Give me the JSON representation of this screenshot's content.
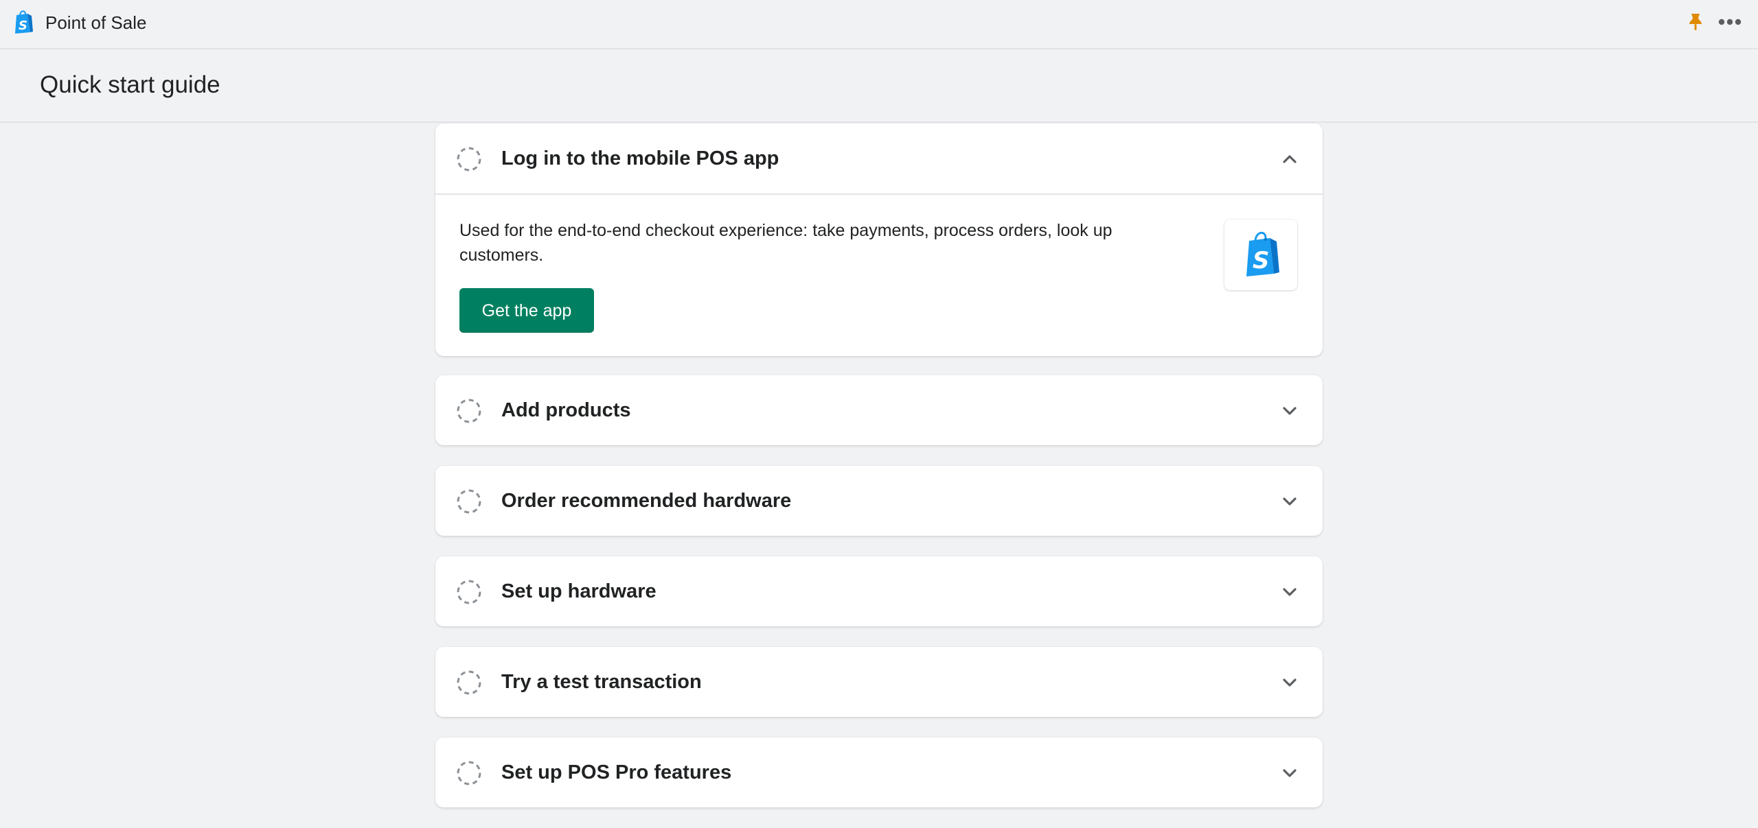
{
  "topbar": {
    "app_title": "Point of Sale",
    "logo_icon": "shopify-bag-icon",
    "pin_icon": "pin-icon",
    "more_icon": "more-horizontal-icon",
    "pin_color": "#e08a00"
  },
  "page": {
    "title": "Quick start guide"
  },
  "colors": {
    "background": "#f1f2f4",
    "primary_button": "#008060",
    "brand_blue": "#1a9cf0",
    "status_circle": "#8c9196",
    "chevron": "#5c5f62"
  },
  "steps": [
    {
      "title": "Log in to the mobile POS app",
      "expanded": true,
      "completed": false,
      "description": "Used for the end-to-end checkout experience: take payments, process orders, look up customers.",
      "button_label": "Get the app",
      "image_icon": "shopify-pos-app-icon"
    },
    {
      "title": "Add products",
      "expanded": false,
      "completed": false
    },
    {
      "title": "Order recommended hardware",
      "expanded": false,
      "completed": false
    },
    {
      "title": "Set up hardware",
      "expanded": false,
      "completed": false
    },
    {
      "title": "Try a test transaction",
      "expanded": false,
      "completed": false
    },
    {
      "title": "Set up POS Pro features",
      "expanded": false,
      "completed": false
    }
  ]
}
